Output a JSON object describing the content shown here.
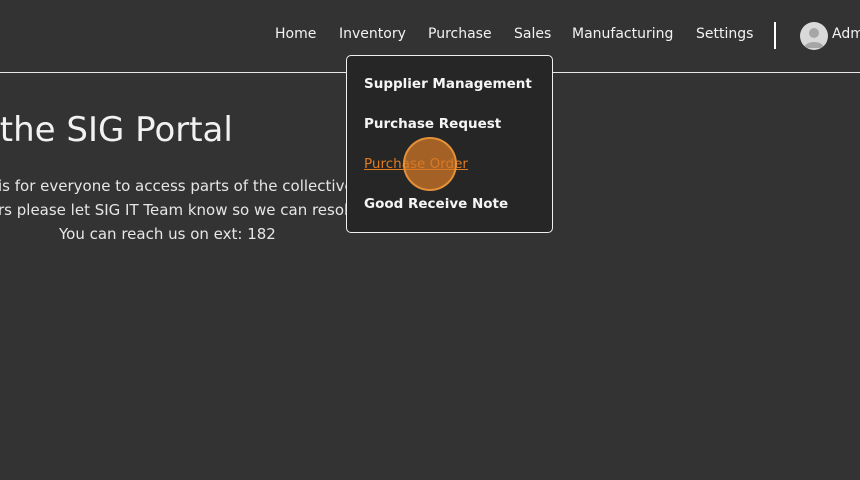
{
  "nav": {
    "items": [
      "Home",
      "Inventory",
      "Purchase",
      "Sales",
      "Manufacturing",
      "Settings"
    ],
    "user_name": "Adm"
  },
  "dropdown": {
    "items": [
      "Supplier Management",
      "Purchase Request",
      "Purchase Order",
      "Good Receive Note"
    ],
    "active_item": "Purchase Order",
    "active_color": "#e07b1f"
  },
  "hero": {
    "title": "me to the SIG Portal",
    "line1": "is for everyone to access parts of the collective",
    "line2": "rs please let SIG IT Team know so we can resol",
    "line3": "You can reach us on ext: 182"
  },
  "colors": {
    "background": "#333333",
    "dropdown_bg": "#262626",
    "accent": "#e07b1f"
  },
  "icons": {
    "avatar": "user-avatar-icon"
  }
}
